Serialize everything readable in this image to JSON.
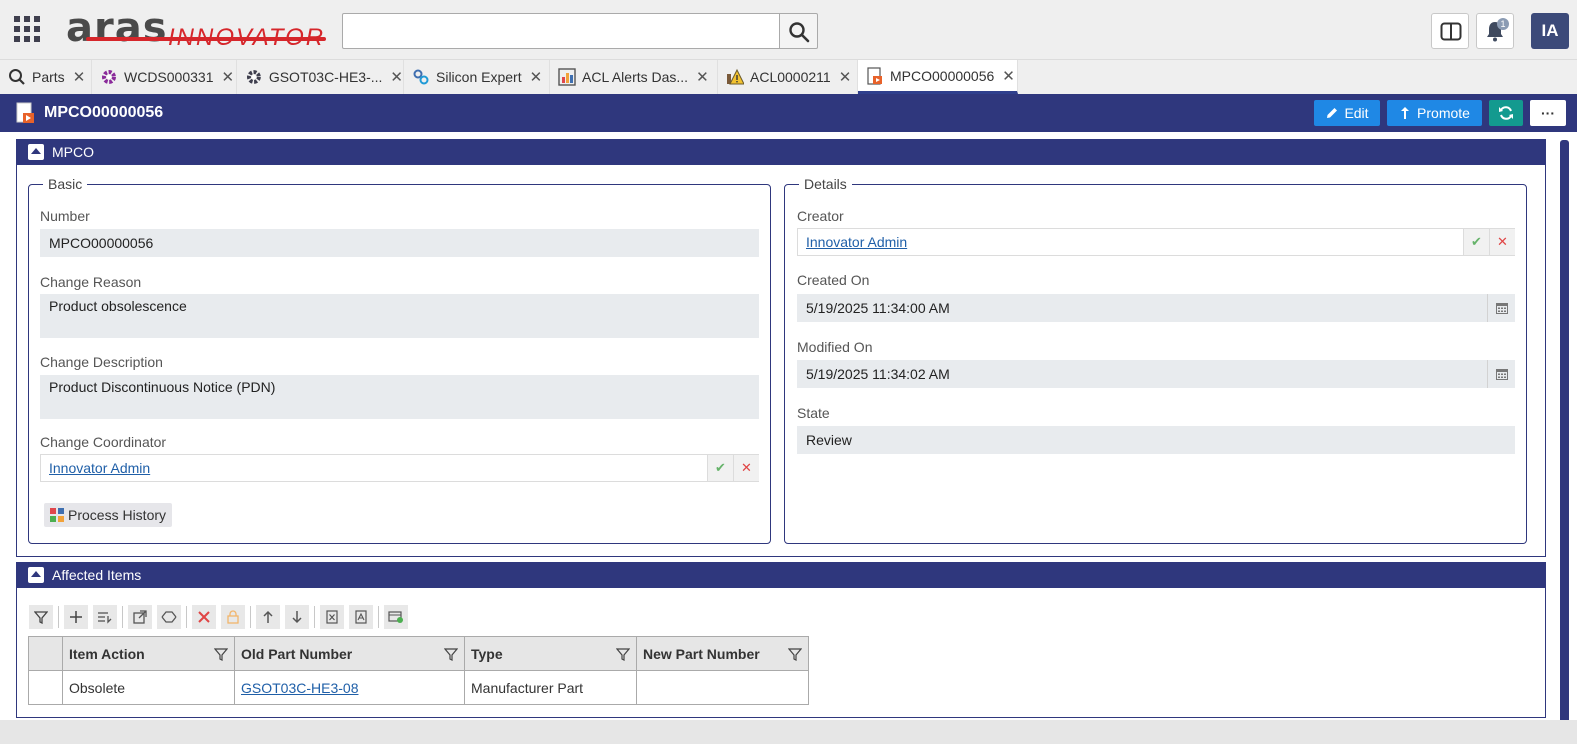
{
  "header": {
    "logo_main": "aras",
    "logo_sub": "INNOVATOR",
    "search_value": "",
    "notification_count": "1",
    "user_initials": "IA"
  },
  "tabs": [
    {
      "label": "Parts",
      "icon": "search-icon"
    },
    {
      "label": "WCDS000331",
      "icon": "gear-purple-icon"
    },
    {
      "label": "GSOT03C-HE3-...",
      "icon": "gear-dark-icon"
    },
    {
      "label": "Silicon Expert",
      "icon": "silicon-expert-icon"
    },
    {
      "label": "ACL Alerts Das...",
      "icon": "chart-icon"
    },
    {
      "label": "ACL0000211",
      "icon": "alert-icon"
    },
    {
      "label": "MPCO00000056",
      "icon": "mpco-icon"
    }
  ],
  "titlebar": {
    "title": "MPCO00000056",
    "edit_label": "Edit",
    "promote_label": "Promote"
  },
  "mpco_section": {
    "title": "MPCO",
    "basic": {
      "legend": "Basic",
      "number_label": "Number",
      "number_value": "MPCO00000056",
      "change_reason_label": "Change Reason",
      "change_reason_value": "Product obsolescence",
      "change_description_label": "Change Description",
      "change_description_value": "Product Discontinuous Notice (PDN)",
      "change_coordinator_label": "Change Coordinator",
      "change_coordinator_value": "Innovator Admin",
      "process_history_label": "Process History"
    },
    "details": {
      "legend": "Details",
      "creator_label": "Creator",
      "creator_value": "Innovator Admin",
      "created_on_label": "Created On",
      "created_on_value": "5/19/2025 11:34:00 AM",
      "modified_on_label": "Modified On",
      "modified_on_value": "5/19/2025 11:34:02 AM",
      "state_label": "State",
      "state_value": "Review"
    }
  },
  "affected_items": {
    "title": "Affected Items",
    "columns": [
      "Item Action",
      "Old Part Number",
      "Type",
      "New Part Number"
    ],
    "rows": [
      {
        "item_action": "Obsolete",
        "old_part_number": "GSOT03C-HE3-08",
        "type": "Manufacturer Part",
        "new_part_number": ""
      }
    ]
  },
  "colors": {
    "brand_dark": "#2f377d",
    "action_blue": "#1f88e5",
    "refresh_teal": "#139a8f",
    "logo_red": "#d6262b"
  }
}
